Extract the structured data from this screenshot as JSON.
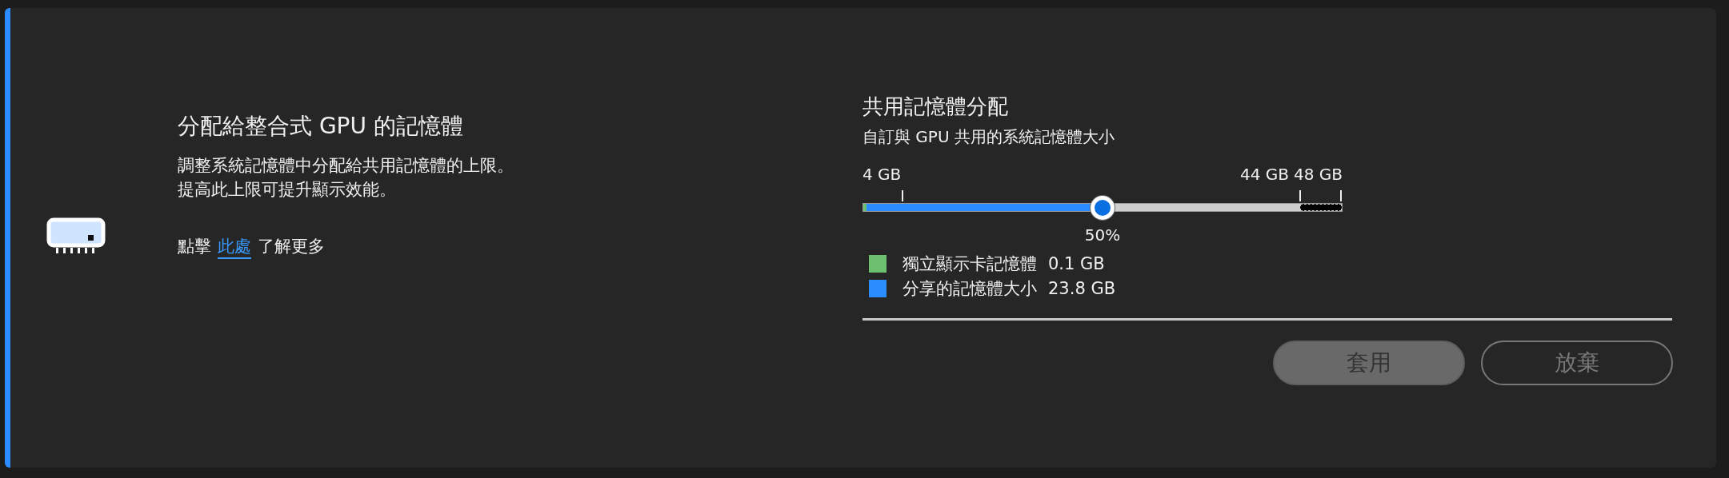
{
  "info": {
    "title": "分配給整合式 GPU 的記憶體",
    "description": [
      "調整系統記憶體中分配給共用記憶體的上限。",
      "提高此上限可提升顯示效能。"
    ],
    "learn_more": {
      "prefix": "點擊",
      "link": "此處",
      "suffix": "了解更多"
    }
  },
  "allocation": {
    "title": "共用記憶體分配",
    "subtitle": "自訂與 GPU 共用的系統記憶體大小",
    "slider": {
      "ticks": [
        "4 GB",
        "44 GB",
        "48 GB"
      ],
      "level": 0.5,
      "reading": "50%"
    },
    "legend": [
      {
        "label": "獨立顯示卡記憶體",
        "value": "0.1 GB",
        "color": "#6cc070"
      },
      {
        "label": "分享的記憶體大小",
        "value": "23.8 GB",
        "color": "#2b8cff"
      }
    ]
  },
  "buttons": [
    {
      "label": "套用",
      "kind": "primary",
      "disabled": true
    },
    {
      "label": "放棄",
      "kind": "secondary",
      "disabled": true
    }
  ]
}
